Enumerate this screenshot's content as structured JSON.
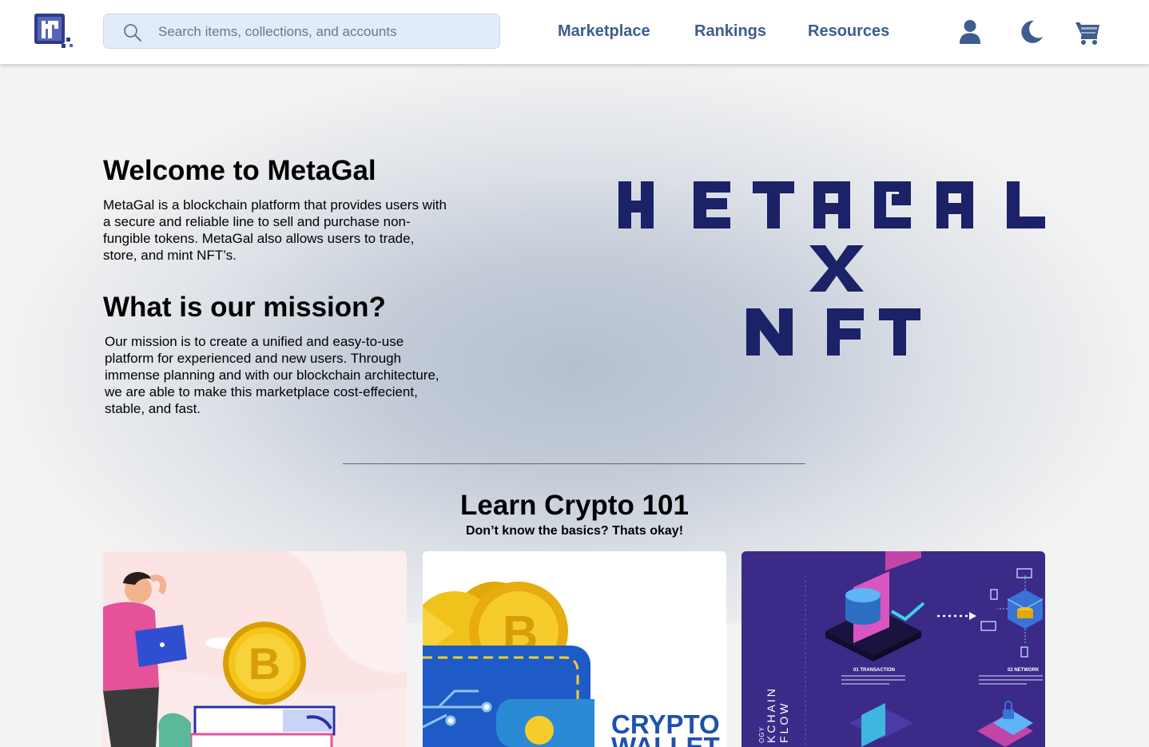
{
  "header": {
    "logo_icon": "metagal-logo-icon",
    "search": {
      "placeholder": "Search items, collections, and accounts",
      "value": ""
    },
    "nav": [
      {
        "label": "Marketplace"
      },
      {
        "label": "Rankings"
      },
      {
        "label": "Resources"
      }
    ],
    "icons": [
      "user-icon",
      "moon-icon",
      "cart-icon"
    ],
    "colors": {
      "nav_text": "#3e5d8e",
      "search_bg": "#e2ebf8"
    }
  },
  "hero": {
    "welcome_title": "Welcome to MetaGal",
    "welcome_text": "MetaGal is a blockchain platform that provides users with a secure and reliable line to sell and purchase non-fungible tokens. MetaGal also allows users to trade, store, and mint NFT’s.",
    "mission_title": "What is our mission?",
    "mission_text": "Our mission is to create a unified and easy-to-use platform for experienced and new users. Through immense planning and with our blockchain architecture, we are able to make this marketplace cost-effecient, stable, and fast.",
    "brand_lines": [
      "METAGAL",
      "X",
      "NFT"
    ],
    "brand_color": "#1b2268"
  },
  "learn": {
    "title": "Learn Crypto 101",
    "subtitle": "Don’t know the basics? Thats okay!",
    "cards": [
      {
        "image": "person-bitcoin-illustration"
      },
      {
        "image": "crypto-wallet-illustration",
        "caption_line1": "CRYPTO",
        "caption_line2": "WALLET"
      },
      {
        "image": "blockchain-flow-infographic",
        "labels": {
          "step1": "01 TRANSACTION",
          "step2": "02 NETWORK",
          "vertical_1": "KCHAIN",
          "vertical_2": "FLOW",
          "vertical_3": "OGY"
        }
      }
    ]
  }
}
